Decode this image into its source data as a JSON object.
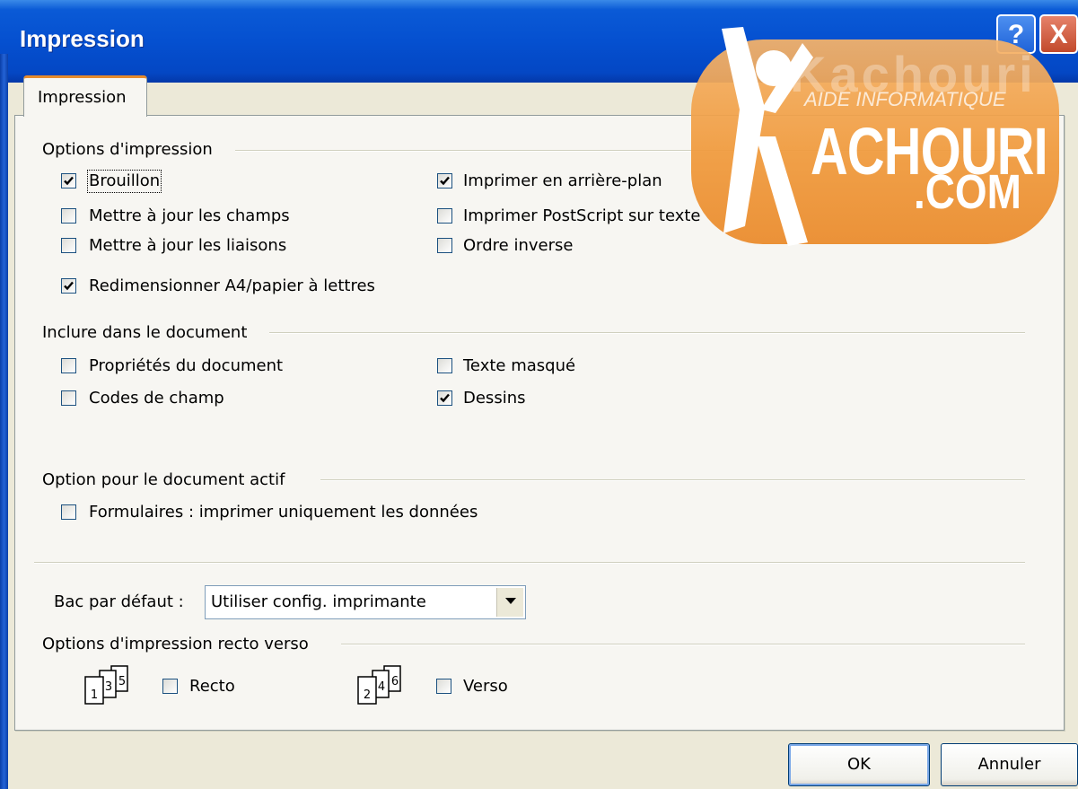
{
  "window": {
    "title": "Impression",
    "help_glyph": "?",
    "close_glyph": "X"
  },
  "watermark": {
    "faint": "Kachouri",
    "subtitle": "AIDE INFORMATIQUE",
    "main": "ACHOURI",
    "suffix": ".COM"
  },
  "tab": {
    "label": "Impression"
  },
  "print_options": {
    "heading": "Options d'impression",
    "draft": {
      "label": "Brouillon",
      "checked": true
    },
    "update_fields": {
      "label": "Mettre à jour les champs",
      "checked": false
    },
    "update_links": {
      "label": "Mettre à jour les liaisons",
      "checked": false
    },
    "resize_a4": {
      "label": "Redimensionner A4/papier à lettres",
      "checked": true
    },
    "background": {
      "label": "Imprimer en arrière-plan",
      "checked": true
    },
    "postscript": {
      "label": "Imprimer PostScript sur texte",
      "checked": false
    },
    "reverse_order": {
      "label": "Ordre inverse",
      "checked": false
    }
  },
  "include": {
    "heading": "Inclure dans le document",
    "doc_properties": {
      "label": "Propriétés du document",
      "checked": false
    },
    "field_codes": {
      "label": "Codes de champ",
      "checked": false
    },
    "hidden_text": {
      "label": "Texte masqué",
      "checked": false
    },
    "drawings": {
      "label": "Dessins",
      "checked": true
    }
  },
  "active_doc": {
    "heading": "Option pour le document actif",
    "forms_data": {
      "label": "Formulaires : imprimer uniquement les données",
      "checked": false
    }
  },
  "tray": {
    "label": "Bac par défaut :",
    "value": "Utiliser config. imprimante"
  },
  "duplex": {
    "heading": "Options d'impression recto verso",
    "recto": {
      "label": "Recto",
      "checked": false,
      "icon_digits": [
        "1",
        "3",
        "5"
      ]
    },
    "verso": {
      "label": "Verso",
      "checked": false,
      "icon_digits": [
        "2",
        "4",
        "6"
      ]
    }
  },
  "buttons": {
    "ok": "OK",
    "cancel": "Annuler"
  },
  "colors": {
    "title_bar": "#0550d0",
    "dialog_bg": "#ece9d8",
    "tab_accent": "#e68b2c",
    "watermark": "#f09a3c"
  }
}
